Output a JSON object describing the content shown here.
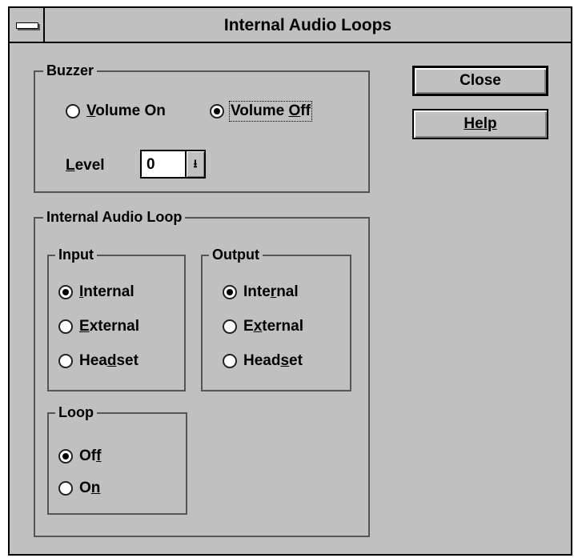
{
  "window": {
    "title": "Internal Audio Loops"
  },
  "buttons": {
    "close": "Close",
    "help": "Help"
  },
  "buzzer": {
    "title": "Buzzer",
    "volume_on": {
      "pre": "",
      "u": "V",
      "post": "olume On"
    },
    "volume_off": {
      "pre": "Volume ",
      "u": "O",
      "post": "ff"
    },
    "selected": "volume_off",
    "level": {
      "pre": "",
      "u": "L",
      "post": "evel",
      "value": "0"
    }
  },
  "loop_group": {
    "title": "Internal Audio Loop",
    "input": {
      "title": "Input",
      "internal": {
        "pre": "",
        "u": "I",
        "post": "nternal"
      },
      "external": {
        "pre": "",
        "u": "E",
        "post": "xternal"
      },
      "headset": {
        "pre": "Hea",
        "u": "d",
        "post": "set"
      },
      "selected": "internal"
    },
    "output": {
      "title": "Output",
      "internal": {
        "pre": "Inte",
        "u": "r",
        "post": "nal"
      },
      "external": {
        "pre": "E",
        "u": "x",
        "post": "ternal"
      },
      "headset": {
        "pre": "Head",
        "u": "s",
        "post": "et"
      },
      "selected": "internal"
    },
    "loop": {
      "title": "Loop",
      "off": {
        "pre": "Of",
        "u": "f",
        "post": ""
      },
      "on": {
        "pre": "O",
        "u": "n",
        "post": ""
      },
      "selected": "off"
    }
  }
}
